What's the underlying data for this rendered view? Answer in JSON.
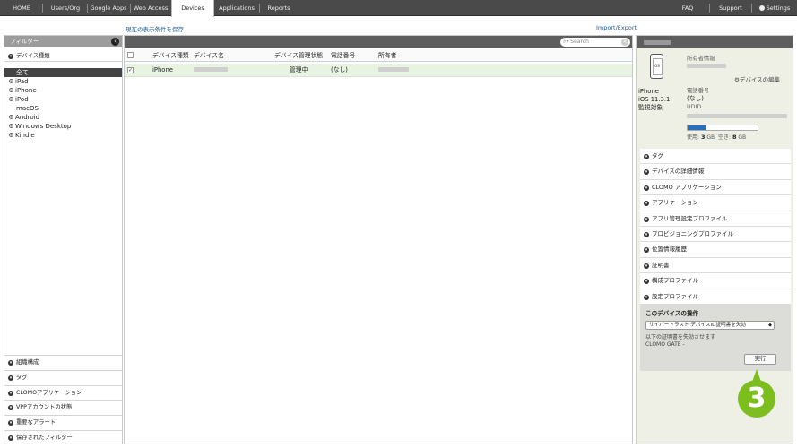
{
  "nav": {
    "tabs": [
      "HOME",
      "Users/Org",
      "Google Apps",
      "Web Access",
      "Devices",
      "Applications",
      "Reports"
    ],
    "active_tab": "Devices",
    "right": [
      "FAQ",
      "Support",
      "Settings"
    ]
  },
  "links": {
    "save_view": "現在の表示条件を保存",
    "import_export": "Import/Export"
  },
  "filter": {
    "title": "フィルター",
    "device_type_header": "デバイス種類",
    "device_types": [
      "全て",
      "iPad",
      "iPhone",
      "iPod",
      "macOS",
      "Android",
      "Windows Desktop",
      "Kindle"
    ],
    "selected_type": "全て",
    "bottom_sections": [
      "組織構成",
      "タグ",
      "CLOMOアプリケーション",
      "VPPアカウントの状態",
      "重要なアラート",
      "保存されたフィルター"
    ]
  },
  "search": {
    "placeholder": "Search"
  },
  "table": {
    "columns": [
      "デバイス種類",
      "デバイス名",
      "デバイス管理状態",
      "電話番号",
      "所有者"
    ],
    "rows": [
      {
        "checked": true,
        "type": "iPhone",
        "name": "",
        "status": "管理中",
        "phone": "(なし)",
        "owner": ""
      }
    ]
  },
  "device": {
    "model": "iPhone",
    "os": "iOS 11.3.1",
    "state": "監視対象",
    "phone_icon_text": "iOS",
    "owner_label": "所有者情報",
    "edit_link": "デバイスの編集",
    "phone_label": "電話番号",
    "phone_value": "(なし)",
    "udid_label": "UDID",
    "usage_used_label": "使用:",
    "usage_used": "3",
    "usage_free_label": "空き:",
    "usage_free": "8",
    "usage_unit": "GB",
    "usage_fraction": 0.27
  },
  "sections": [
    "タグ",
    "デバイスの詳細情報",
    "CLOMO アプリケーション",
    "アプリケーション",
    "アプリ管理設定プロファイル",
    "プロビジョニングプロファイル",
    "位置情報履歴",
    "証明書",
    "構成プロファイル",
    "設定プロファイル"
  ],
  "operations": {
    "title": "このデバイスの操作",
    "selected_action": "サイバートラスト デバイスID証明書を失効",
    "description_line1": "以下の証明書を失効させます",
    "description_line2": "CLOMO GATE -",
    "execute_label": "実行"
  },
  "step_marker": "3",
  "colors": {
    "accent_green": "#7dbe1f",
    "row_highlight": "#e8f3e2",
    "progress_blue": "#2a6fbd"
  }
}
